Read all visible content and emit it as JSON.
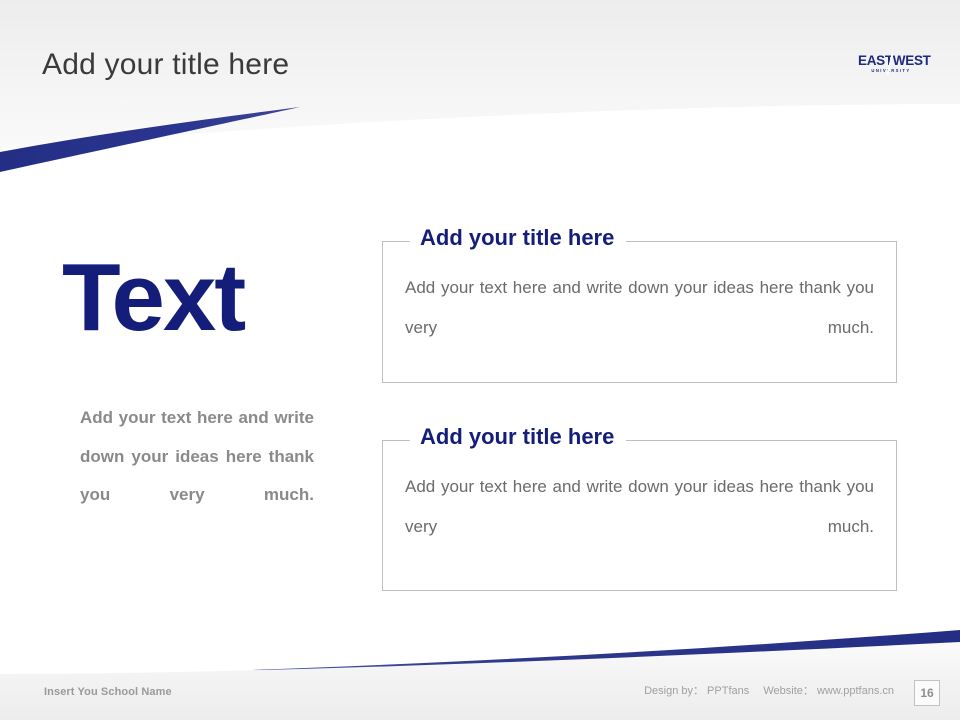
{
  "slide": {
    "title": "Add your title here",
    "page_number": "16",
    "accent_navy": "#141d7a",
    "accent_swoosh": "#2b3585",
    "header_gray": "#f1f1f1",
    "body_gray": "#6b6b6b",
    "muted_gray": "#8a8a8a"
  },
  "logo": {
    "name": "eastwest-university-logo",
    "main": "EASTWEST",
    "sub": "UNIVERSITY"
  },
  "left": {
    "headline": "Text",
    "paragraph": "Add your text here and write down your ideas here thank you very much."
  },
  "boxes": [
    {
      "legend": "Add your title here",
      "body": "Add your text here and write down your ideas here thank you very much."
    },
    {
      "legend": "Add your title here",
      "body": "Add your text here and write down your ideas here thank you very much."
    }
  ],
  "footer": {
    "school_name": "Insert You School Name",
    "design_by": "Design by： PPTfans",
    "website": "Website： www.pptfans.cn"
  }
}
